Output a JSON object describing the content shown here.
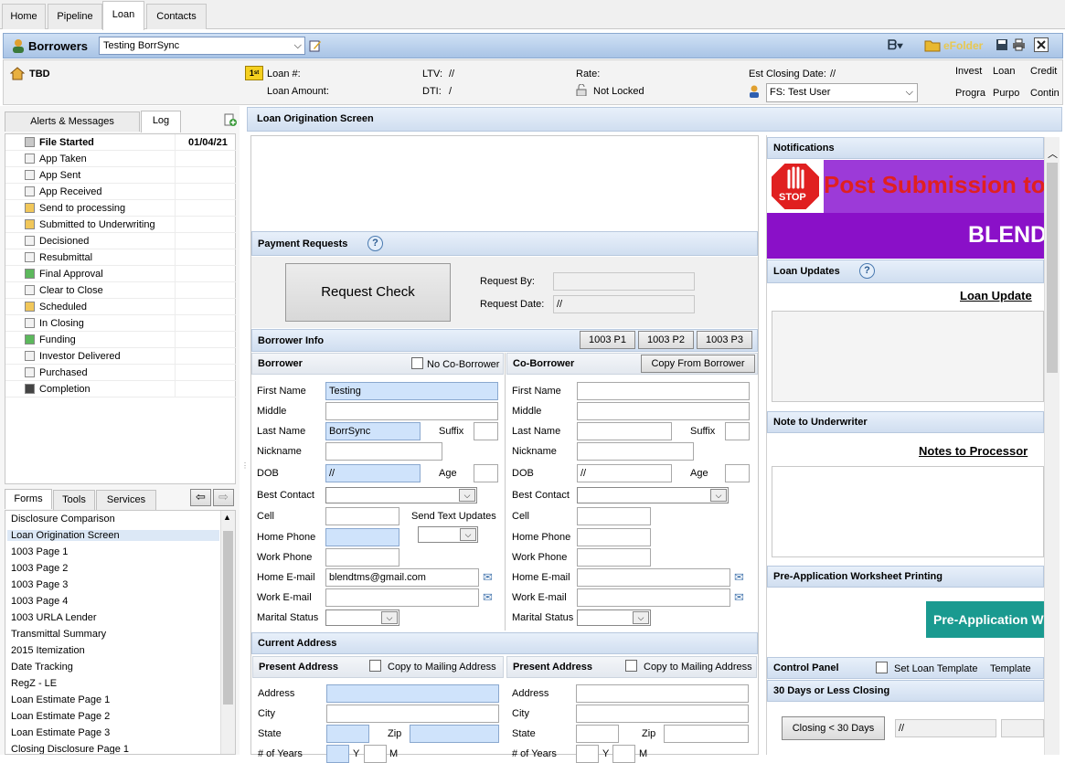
{
  "top_tabs": [
    "Home",
    "Pipeline",
    "Loan",
    "Contacts"
  ],
  "borrowers_bar": {
    "title": "Borrowers",
    "selected": "Testing BorrSync",
    "efolder": "eFolder"
  },
  "loan_header": {
    "name": "TBD",
    "loan_num_label": "Loan #:",
    "loan_amount_label": "Loan Amount:",
    "ltv_label": "LTV:",
    "ltv_value": "//",
    "dti_label": "DTI:",
    "dti_value": "/",
    "rate_label": "Rate:",
    "lock_status": "Not Locked",
    "closing_label": "Est Closing Date:",
    "closing_value": "//",
    "officer": "FS: Test User",
    "right_cols": [
      "Invest",
      "Loan",
      "Credit",
      "Progra",
      "Purpo",
      "Contin"
    ]
  },
  "left_tabs": {
    "alerts": "Alerts & Messages",
    "log": "Log"
  },
  "log_items": [
    {
      "label": "File Started",
      "date": "01/04/21",
      "bold": true,
      "color": "#c8c8c8"
    },
    {
      "label": "App Taken",
      "color": "#f2f2f2"
    },
    {
      "label": "App Sent",
      "color": "#f2f2f2"
    },
    {
      "label": "App Received",
      "color": "#f2f2f2"
    },
    {
      "label": "Send to processing",
      "color": "#f1c75a"
    },
    {
      "label": "Submitted to Underwriting",
      "color": "#f1c75a"
    },
    {
      "label": "Decisioned",
      "color": "#f2f2f2"
    },
    {
      "label": "Resubmittal",
      "color": "#f2f2f2"
    },
    {
      "label": "Final Approval",
      "color": "#5cb85c"
    },
    {
      "label": "Clear to Close",
      "color": "#f2f2f2"
    },
    {
      "label": "Scheduled",
      "color": "#f1c75a"
    },
    {
      "label": "In Closing",
      "color": "#f2f2f2"
    },
    {
      "label": "Funding",
      "color": "#5cb85c"
    },
    {
      "label": "Investor Delivered",
      "color": "#f2f2f2"
    },
    {
      "label": "Purchased",
      "color": "#f2f2f2"
    },
    {
      "label": "Completion",
      "color": "#444444"
    }
  ],
  "bottom_tabs": [
    "Forms",
    "Tools",
    "Services"
  ],
  "forms": [
    "Disclosure Comparison",
    "Loan Origination Screen",
    "1003 Page 1",
    "1003 Page 2",
    "1003 Page 3",
    "1003 Page 4",
    "1003 URLA Lender",
    "Transmittal Summary",
    "2015 Itemization",
    "Date Tracking",
    "RegZ - LE",
    "Loan Estimate Page 1",
    "Loan Estimate Page 2",
    "Loan Estimate Page 3",
    "Closing Disclosure Page 1"
  ],
  "main": {
    "title": "Loan Origination Screen",
    "payment_requests": "Payment Requests",
    "request_check": "Request Check",
    "request_by": "Request By:",
    "request_date": "Request Date:",
    "request_date_value": "//",
    "borrower_info": "Borrower Info",
    "p_buttons": [
      "1003 P1",
      "1003 P2",
      "1003 P3"
    ],
    "borrower": "Borrower",
    "no_coborrower": "No Co-Borrower",
    "coborrower": "Co-Borrower",
    "copy_from_borrower": "Copy From Borrower",
    "labels": {
      "first": "First Name",
      "middle": "Middle",
      "last": "Last Name",
      "suffix": "Suffix",
      "nickname": "Nickname",
      "dob": "DOB",
      "age": "Age",
      "best_contact": "Best Contact",
      "cell": "Cell",
      "send_text": "Send Text Updates",
      "home_phone": "Home Phone",
      "work_phone": "Work Phone",
      "home_email": "Home E-mail",
      "work_email": "Work E-mail",
      "marital": "Marital Status"
    },
    "b_values": {
      "first": "Testing",
      "last": "BorrSync",
      "dob": "//",
      "home_email": "blendtms@gmail.com"
    },
    "c_values": {
      "dob": "//"
    },
    "current_address": "Current Address",
    "present_address": "Present Address",
    "copy_mailing": "Copy to Mailing Address",
    "addr_labels": {
      "address": "Address",
      "city": "City",
      "state": "State",
      "zip": "Zip",
      "years": "# of Years",
      "y": "Y",
      "m": "M"
    }
  },
  "right": {
    "notifications": "Notifications",
    "stop": "STOP",
    "banner_line1": "Post Submission to",
    "banner_line2": "BLEND",
    "loan_updates": "Loan Updates",
    "loan_update_link": "Loan Update",
    "note_underwriter": "Note to Underwriter",
    "notes_processor": "Notes to Processor",
    "preapp": "Pre-Application Worksheet Printing",
    "preapp_button": "Pre-Application W",
    "control_panel": "Control Panel",
    "set_template": "Set Loan Template",
    "template": "Template",
    "closing30": "30 Days or Less Closing",
    "closing_btn": "Closing < 30 Days",
    "closing_val": "//"
  }
}
